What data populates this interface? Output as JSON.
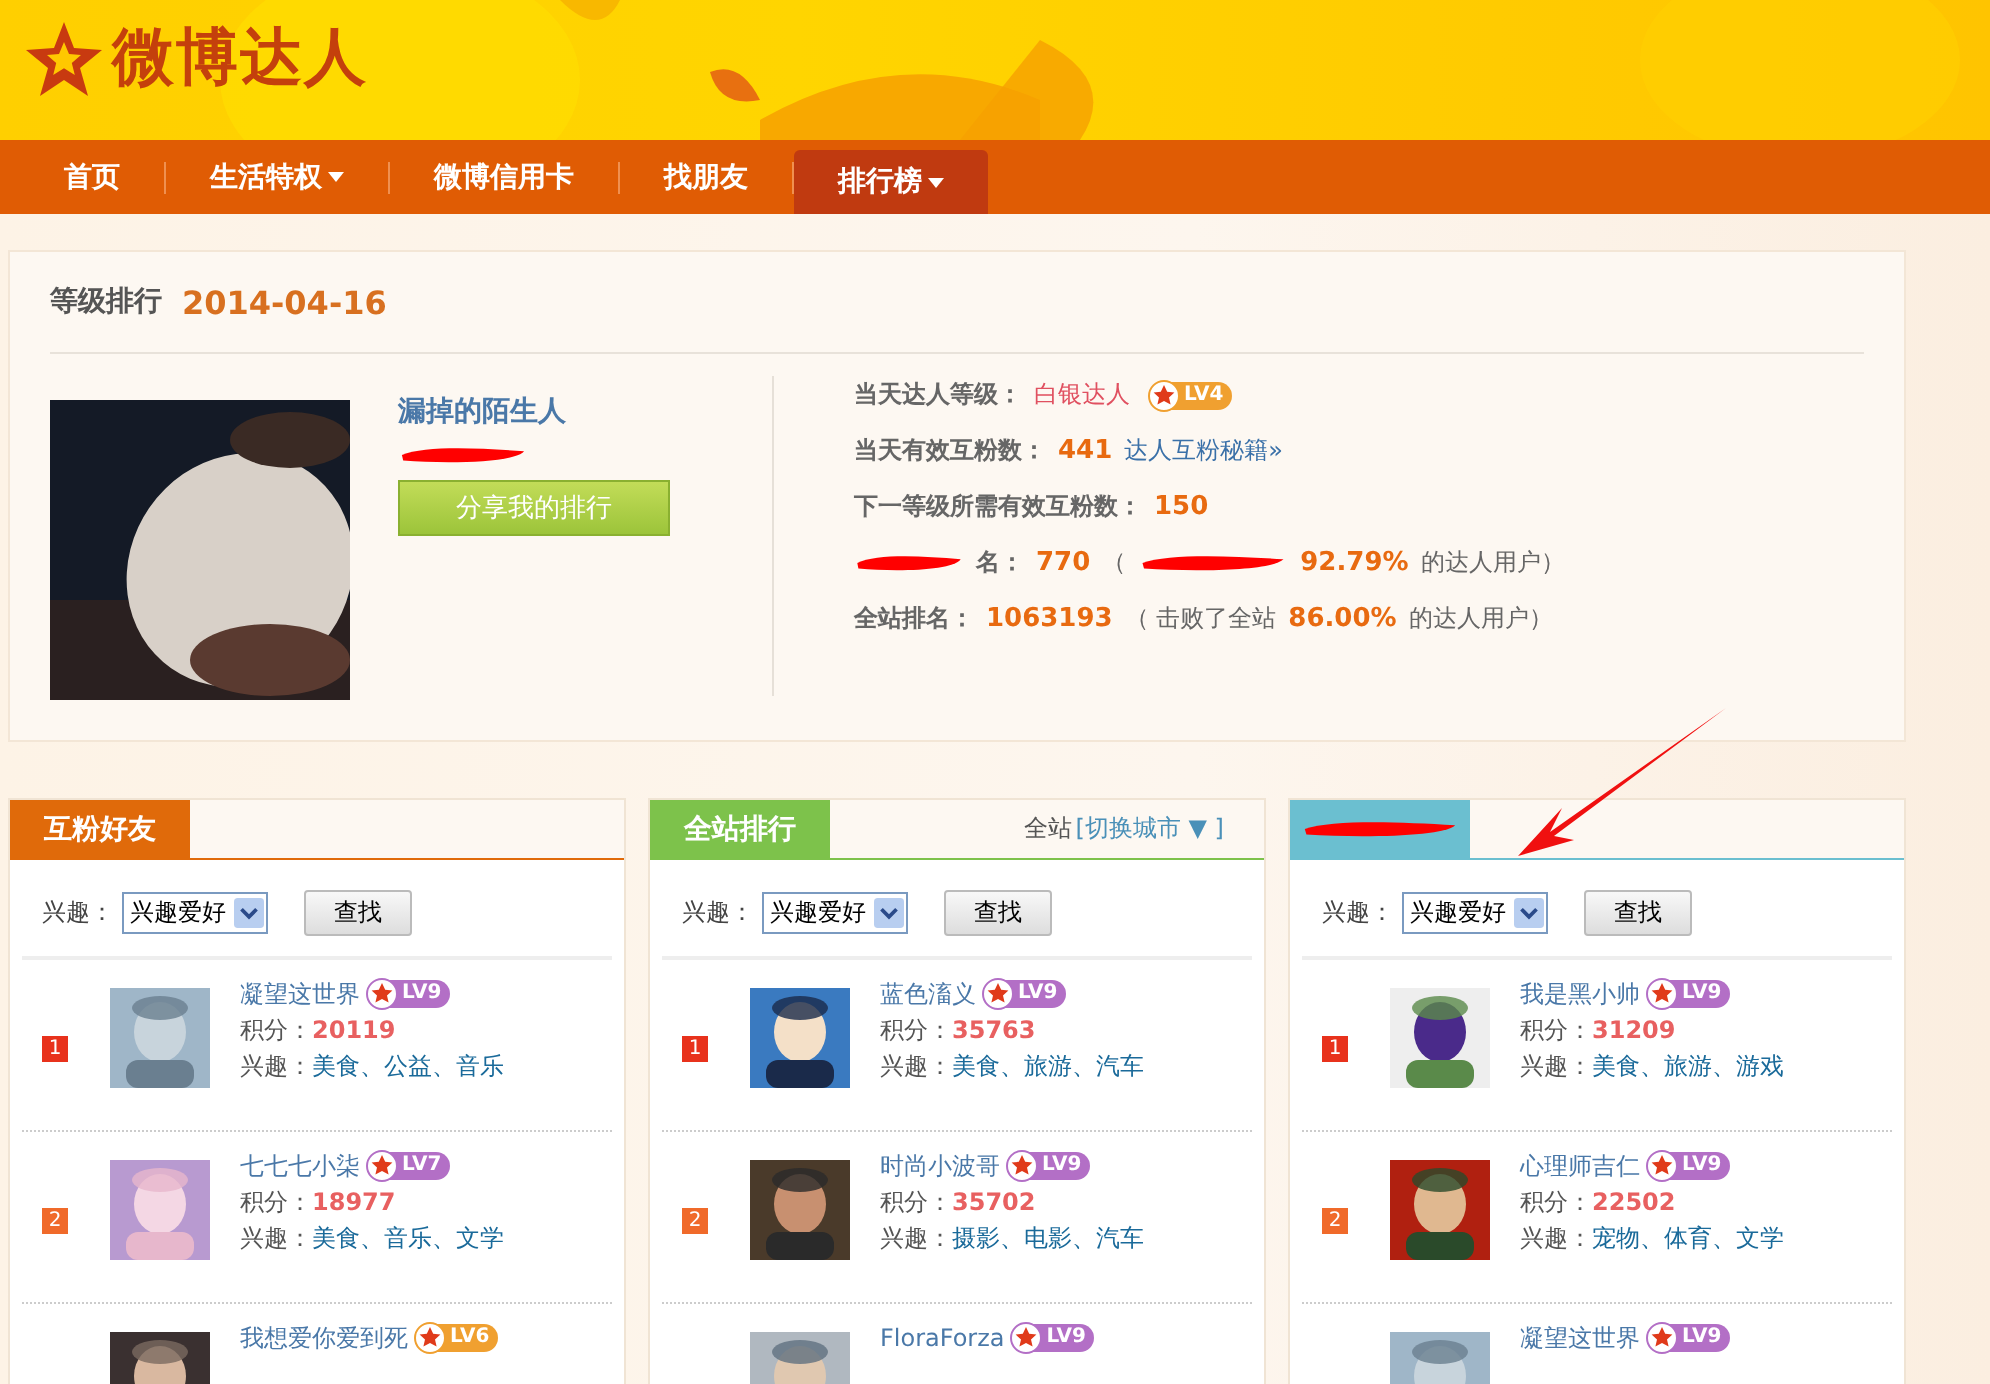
{
  "header": {
    "logo_text": "微博达人"
  },
  "nav": [
    {
      "label": "首页",
      "has_menu": false,
      "selected": false
    },
    {
      "label": "生活特权",
      "has_menu": true,
      "selected": false
    },
    {
      "label": "微博信用卡",
      "has_menu": false,
      "selected": false
    },
    {
      "label": "找朋友",
      "has_menu": false,
      "selected": false
    },
    {
      "label": "排行榜",
      "has_menu": true,
      "selected": true
    }
  ],
  "summary": {
    "title": "等级排行",
    "date": "2014-04-16",
    "user": {
      "name": "漏掉的陌生人",
      "handle_redacted": true,
      "share_button": "分享我的排行"
    },
    "stats": [
      {
        "parts": [
          {
            "kind": "label",
            "text": "当天达人等级："
          },
          {
            "kind": "highlight",
            "text": "白银达人"
          },
          {
            "kind": "badge",
            "text": "LV4",
            "color": "#f0a030"
          }
        ]
      },
      {
        "parts": [
          {
            "kind": "label",
            "text": "当天有效互粉数："
          },
          {
            "kind": "value",
            "text": "441"
          },
          {
            "kind": "link",
            "text": "达人互粉秘籍»"
          }
        ]
      },
      {
        "parts": [
          {
            "kind": "label",
            "text": "下一等级所需有效互粉数："
          },
          {
            "kind": "value",
            "text": "150"
          }
        ]
      },
      {
        "parts": [
          {
            "kind": "redacted"
          },
          {
            "kind": "label",
            "text": "名："
          },
          {
            "kind": "value",
            "text": "770"
          },
          {
            "kind": "note",
            "text": "（"
          },
          {
            "kind": "redacted"
          },
          {
            "kind": "value",
            "text": "92.79%"
          },
          {
            "kind": "note",
            "text": "的达人用户）"
          }
        ]
      },
      {
        "parts": [
          {
            "kind": "label",
            "text": "全站排名："
          },
          {
            "kind": "value",
            "text": "1063193"
          },
          {
            "kind": "note",
            "text": "（ 击败了全站"
          },
          {
            "kind": "value",
            "text": "86.00%"
          },
          {
            "kind": "note",
            "text": "的达人用户）"
          }
        ]
      }
    ]
  },
  "panels": [
    {
      "title": "互粉好友",
      "title_redacted": false,
      "color": "#e06a0a",
      "filter": {
        "label": "兴趣：",
        "select_value": "兴趣爱好",
        "button": "查找"
      },
      "rows": [
        {
          "rank": {
            "text": "1",
            "color": "#e8321c"
          },
          "name": "凝望这世界",
          "level": {
            "text": "LV9",
            "color": "#b36fc6"
          },
          "score_label": "积分：",
          "score": "20119",
          "interest_label": "兴趣：",
          "interests": "美食、公益、音乐"
        },
        {
          "rank": {
            "text": "2",
            "color": "#f06a2a"
          },
          "name": "七七七小柒",
          "level": {
            "text": "LV7",
            "color": "#b36fc6"
          },
          "score_label": "积分：",
          "score": "18977",
          "interest_label": "兴趣：",
          "interests": "美食、音乐、文学"
        },
        {
          "name": "我想爱你爱到死",
          "level": {
            "text": "LV6",
            "color": "#f0a030"
          }
        }
      ]
    },
    {
      "title": "全站排行",
      "title_redacted": false,
      "color": "#7dc24b",
      "scope": "全站",
      "city_link": "[切换城市 ▼ ]",
      "filter": {
        "label": "兴趣：",
        "select_value": "兴趣爱好",
        "button": "查找"
      },
      "rows": [
        {
          "rank": {
            "text": "1",
            "color": "#e8321c"
          },
          "name": "蓝色滀义",
          "level": {
            "text": "LV9",
            "color": "#b36fc6"
          },
          "score_label": "积分：",
          "score": "35763",
          "interest_label": "兴趣：",
          "interests": "美食、旅游、汽车"
        },
        {
          "rank": {
            "text": "2",
            "color": "#f06a2a"
          },
          "name": "时尚小波哥",
          "level": {
            "text": "LV9",
            "color": "#b36fc6"
          },
          "score_label": "积分：",
          "score": "35702",
          "interest_label": "兴趣：",
          "interests": "摄影、电影、汽车"
        },
        {
          "name": "FloraForza",
          "level": {
            "text": "LV9",
            "color": "#b36fc6"
          }
        }
      ]
    },
    {
      "title_redacted": true,
      "color": "#6bbfd0",
      "filter": {
        "label": "兴趣：",
        "select_value": "兴趣爱好",
        "button": "查找"
      },
      "rows": [
        {
          "rank": {
            "text": "1",
            "color": "#e8321c"
          },
          "name": "我是黑小帅",
          "level": {
            "text": "LV9",
            "color": "#b36fc6"
          },
          "score_label": "积分：",
          "score": "31209",
          "interest_label": "兴趣：",
          "interests": "美食、旅游、游戏"
        },
        {
          "rank": {
            "text": "2",
            "color": "#f06a2a"
          },
          "name": "心理师吉仁",
          "level": {
            "text": "LV9",
            "color": "#b36fc6"
          },
          "score_label": "积分：",
          "score": "22502",
          "interest_label": "兴趣：",
          "interests": "宠物、体育、文学"
        },
        {
          "name": "凝望这世界",
          "level": {
            "text": "LV9",
            "color": "#b36fc6"
          }
        }
      ]
    }
  ],
  "annotation": {
    "kind": "arrow"
  }
}
